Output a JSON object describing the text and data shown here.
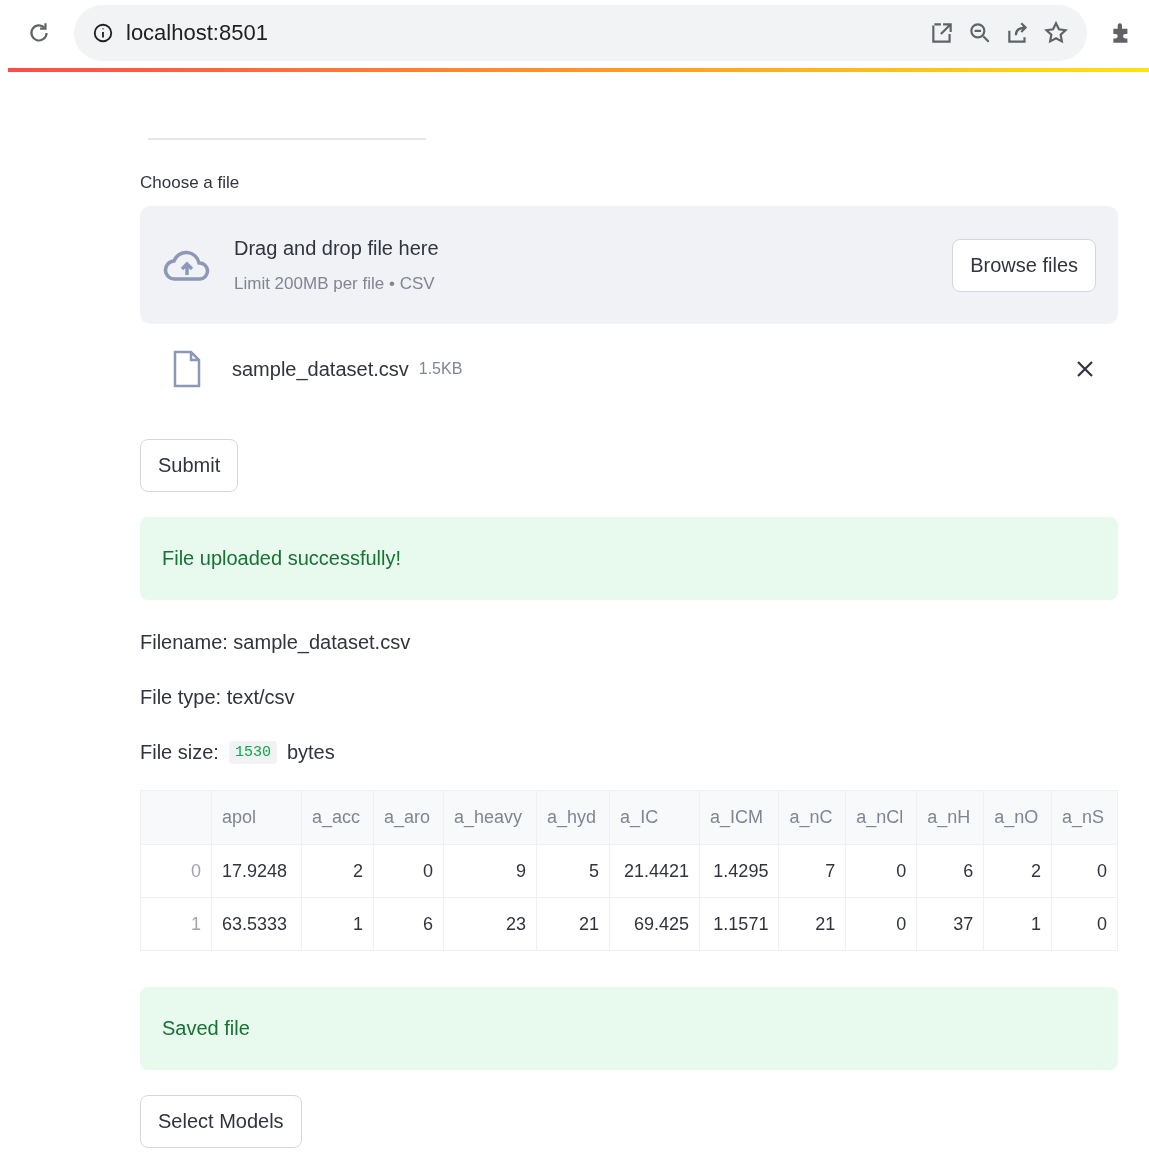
{
  "browser": {
    "url": "localhost:8501"
  },
  "uploader": {
    "label": "Choose a file",
    "drop_text": "Drag and drop file here",
    "limit_text": "Limit 200MB per file • CSV",
    "browse_button": "Browse files",
    "file": {
      "name": "sample_dataset.csv",
      "size": "1.5KB"
    }
  },
  "submit_button": "Submit",
  "success_alert": "File uploaded successfully!",
  "info": {
    "filename": "Filename: sample_dataset.csv",
    "file_type": "File type: text/csv",
    "file_size_label": "File size:",
    "file_size_value": "1530",
    "file_size_unit": "bytes"
  },
  "table": {
    "columns": [
      "apol",
      "a_acc",
      "a_aro",
      "a_heavy",
      "a_hyd",
      "a_IC",
      "a_ICM",
      "a_nC",
      "a_nCl",
      "a_nH",
      "a_nO",
      "a_nS"
    ],
    "rows": [
      {
        "index": "0",
        "cells": [
          "17.9248",
          "2",
          "0",
          "9",
          "5",
          "21.4421",
          "1.4295",
          "7",
          "0",
          "6",
          "2",
          "0"
        ]
      },
      {
        "index": "1",
        "cells": [
          "63.5333",
          "1",
          "6",
          "23",
          "21",
          "69.425",
          "1.1571",
          "21",
          "0",
          "37",
          "1",
          "0"
        ]
      }
    ]
  },
  "saved_alert": "Saved file",
  "select_models_button": "Select Models"
}
